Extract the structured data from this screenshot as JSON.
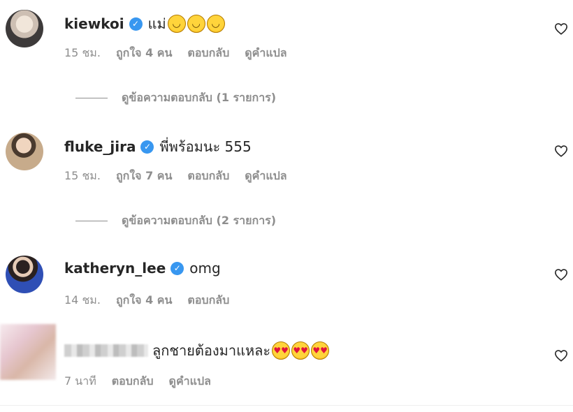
{
  "comments": [
    {
      "username": "kiewkoi",
      "verified": true,
      "text": "แม่",
      "emojis": [
        "😂",
        "😂",
        "😂"
      ],
      "time": "15 ชม.",
      "likes": "ถูกใจ 4 คน",
      "reply": "ตอบกลับ",
      "translate": "ดูคำแปล",
      "view_replies": "ดูข้อความตอบกลับ (1 รายการ)"
    },
    {
      "username": "fluke_jira",
      "verified": true,
      "text": "พี่พร้อมนะ 555",
      "time": "15 ชม.",
      "likes": "ถูกใจ 7 คน",
      "reply": "ตอบกลับ",
      "translate": "ดูคำแปล",
      "view_replies": "ดูข้อความตอบกลับ (2 รายการ)"
    },
    {
      "username": "katheryn_lee",
      "verified": true,
      "text": "omg",
      "time": "14 ชม.",
      "likes": "ถูกใจ 4 คน",
      "reply": "ตอบกลับ"
    },
    {
      "text": "ลูกชายต้องมาแหละ",
      "emojis": [
        "😍",
        "😍",
        "😍"
      ],
      "time": "7 นาที",
      "reply": "ตอบกลับ",
      "translate": "ดูคำแปล"
    }
  ],
  "icons": {
    "like": "heart-outline-icon",
    "verified": "verified-badge-icon"
  },
  "colors": {
    "verified": "#3897f0",
    "meta_text": "#8e8e8e",
    "primary_text": "#262626"
  }
}
